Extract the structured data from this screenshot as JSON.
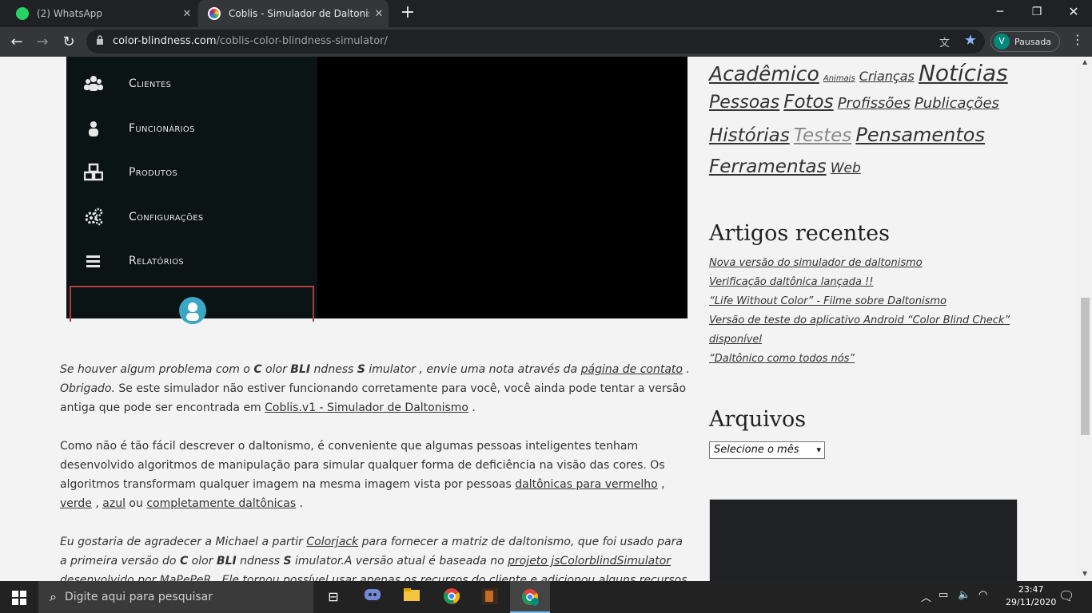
{
  "browser": {
    "tabs": [
      {
        "label": "(2) WhatsApp",
        "icon": "whatsapp-icon"
      },
      {
        "label": "Coblis - Simulador de Daltonismo",
        "icon": "coblis-icon"
      }
    ],
    "url_host": "color-blindness.com",
    "url_path": "/coblis-color-blindness-simulator/",
    "profile_initial": "V",
    "profile_label": "Pausada"
  },
  "demo_app": {
    "menu": [
      {
        "label": "Clientes",
        "icon": "users-icon"
      },
      {
        "label": "Funcionários",
        "icon": "user-icon"
      },
      {
        "label": "Produtos",
        "icon": "cubes-icon"
      },
      {
        "label": "Configurações",
        "icon": "cogs-icon"
      },
      {
        "label": "Relatórios",
        "icon": "bars-icon"
      }
    ]
  },
  "article": {
    "p1": {
      "t1": "Se houver algum problema com o ",
      "c": "C",
      "t2": " olor ",
      "bli": "BLI",
      "t3": " ndness ",
      "s": "S",
      "t4": " imulator , envie uma nota através da ",
      "link1": "página de contato",
      "t5": " . Obrigado.",
      "t6": " Se este simulador não estiver funcionando corretamente para você, você ainda pode tentar a versão antiga que pode ser encontrada em ",
      "link2": "Coblis.v1 - Simulador de Daltonismo",
      "t7": " ."
    },
    "p2": {
      "t1": "Como não é tão fácil descrever o daltonismo, é conveniente que algumas pessoas inteligentes tenham desenvolvido algoritmos de manipulação para simular qualquer forma de deficiência na visão das cores. Os algoritmos transformam qualquer imagem na mesma imagem vista por pessoas ",
      "link1": "daltônicas para vermelho",
      "t2": " , ",
      "link2": "verde",
      "t3": " , ",
      "link3": "azul",
      "t4": " ou ",
      "link4": "completamente daltônicas",
      "t5": " ."
    },
    "p3": {
      "t1": "Eu gostaria de agradecer a Michael a partir ",
      "link1": "Colorjack",
      "t2": " para fornecer a matriz de daltonismo, que foi usado para a primeira versão do ",
      "c": "C",
      "t3": " olor ",
      "bli": "BLI",
      "t4": " ndness ",
      "s": "S",
      "t5": " imulator.A versão atual é baseada no ",
      "link2": "projeto jsColorblindSimulator",
      "t6": " desenvolvido por ",
      "link3": "MaPePeR",
      "t7": " . Ele tornou possível usar apenas os recursos do cliente e adicionou alguns recursos muito interessantes, como panorâmica e"
    }
  },
  "sidebar": {
    "tags": [
      {
        "label": "Acadêmico",
        "size": 25
      },
      {
        "label": "Animais",
        "size": 10
      },
      {
        "label": "Crianças",
        "size": 16
      },
      {
        "label": "Notícias",
        "size": 28
      },
      {
        "label": "Pessoas",
        "size": 22
      },
      {
        "label": "Fotos",
        "size": 25
      },
      {
        "label": "Profissões",
        "size": 19
      },
      {
        "label": "Publicações",
        "size": 19
      },
      {
        "label": "Histórias",
        "size": 25
      },
      {
        "label": "Testes",
        "size": 25,
        "faded": true
      },
      {
        "label": "Pensamentos",
        "size": 26
      },
      {
        "label": "Ferramentas",
        "size": 25
      },
      {
        "label": "Web",
        "size": 18
      }
    ],
    "recent_title": "Artigos recentes",
    "recent": [
      "Nova versão do simulador de daltonismo",
      "Verificação daltônica lançada !!",
      "“Life Without Color” - Filme sobre Daltonismo",
      "Versão de teste do aplicativo Android “Color Blind Check”",
      "disponível",
      "“Daltônico como todos nós”"
    ],
    "archive_title": "Arquivos",
    "archive_select": "Selecione o mês"
  },
  "taskbar": {
    "search_placeholder": "Digite aqui para pesquisar",
    "time": "23:47",
    "date": "29/11/2020"
  },
  "colors": {
    "chrome_dark": "#202124",
    "chrome_toolbar": "#35363a",
    "page_bg": "#f3f3f3",
    "demo_sidebar": "#0b1415",
    "accent_red": "#b23b3b",
    "avatar_teal": "#00897b"
  }
}
